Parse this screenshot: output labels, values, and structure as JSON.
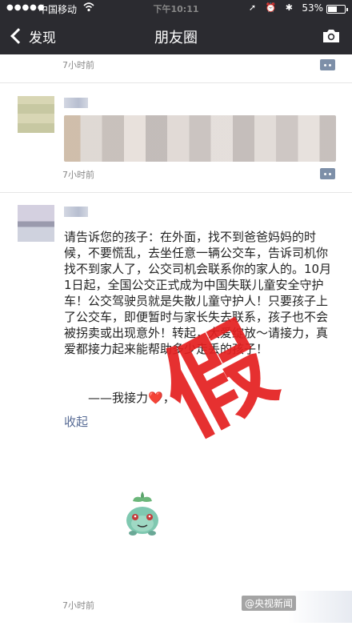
{
  "status_bar": {
    "signal": "●●●●●",
    "carrier": "中国移动",
    "wifi_icon": "wifi-icon",
    "time": "下午10:11",
    "icons": "➚ ⏰ ✱",
    "battery_percent": "53%",
    "battery_level": 0.53
  },
  "nav": {
    "back_label": "发现",
    "title": "朋友圈",
    "camera_icon": "camera-icon"
  },
  "posts": [
    {
      "time": "7小时前"
    },
    {
      "time": "7小时前"
    },
    {
      "text": "请告诉您的孩子：在外面，找不到爸爸妈妈的时候，不要慌乱，去坐任意一辆公交车，告诉司机你找不到家人了，公交司机会联系你的家人的。10月1日起，全国公交正式成为中国失联儿童安全守护车！公交驾驶员就是失散儿童守护人！只要孩子上了公交车，即便暂时与家长失去联系，孩子也不会被拐卖或出现意外！转起，大爱绽放～请接力，真爱都接力起来能帮助多少走丢的孩子！",
      "relay": "——我接力",
      "heart": "❤️",
      "relay_suffix": "，",
      "collapse_label": "收起",
      "time": "7小时前"
    }
  ],
  "stamp_text": "假",
  "watermark": "@央视新闻",
  "colors": {
    "bar_bg": "#2b2b30",
    "link": "#576b95",
    "stamp_red": "#e41f1f"
  }
}
